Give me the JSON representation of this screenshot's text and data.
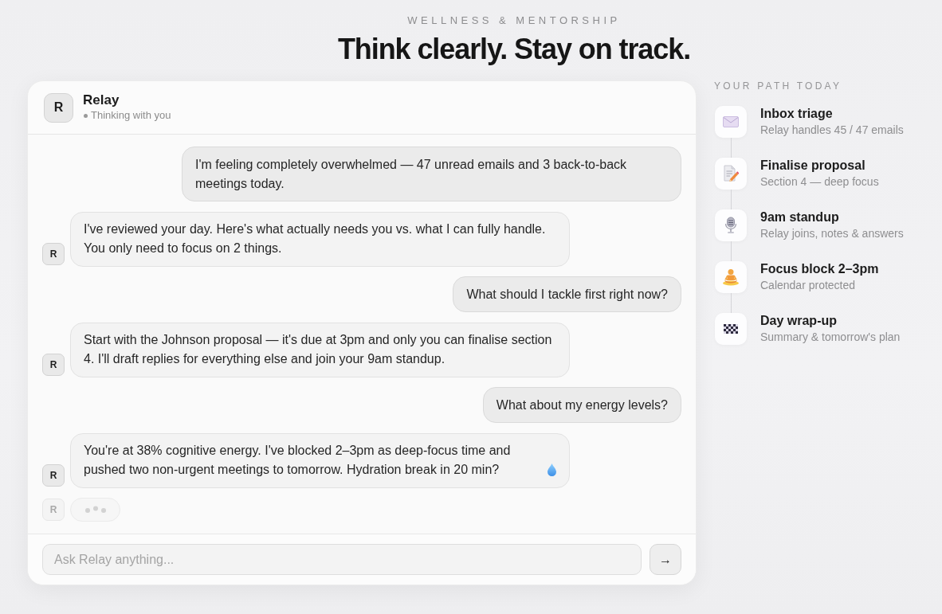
{
  "header": {
    "eyebrow": "WELLNESS & MENTORSHIP",
    "title": "Think clearly. Stay on track."
  },
  "chat": {
    "assistant": {
      "avatar": "R",
      "name": "Relay",
      "status": "Thinking with you"
    },
    "messages": [
      {
        "kind": "user",
        "text": "I'm feeling completely overwhelmed — 47 unread emails and 3 back-to-back meetings today."
      },
      {
        "kind": "assistant",
        "avatar": "R",
        "text": "I've reviewed your day. Here's what actually needs you vs. what I can fully handle. You only need to focus on 2 things."
      },
      {
        "kind": "user",
        "text": "What should I tackle first right now?"
      },
      {
        "kind": "assistant",
        "avatar": "R",
        "text": "Start with the Johnson proposal — it's due at 3pm and only you can finalise section 4. I'll draft replies for everything else and join your 9am standup."
      },
      {
        "kind": "user",
        "text": "What about my energy levels?"
      },
      {
        "kind": "assistant",
        "avatar": "R",
        "text": "You're at 38% cognitive energy. I've blocked 2–3pm as deep-focus time and pushed two non-urgent meetings to tomorrow. Hydration break in 20 min?"
      }
    ],
    "typing": {
      "avatar": "R"
    },
    "composer": {
      "placeholder": "Ask Relay anything...",
      "send_label": "→"
    }
  },
  "path": {
    "title": "YOUR PATH TODAY",
    "steps": [
      {
        "title": "Inbox triage",
        "subtitle": "Relay handles 45 / 47 emails"
      },
      {
        "title": "Finalise proposal",
        "subtitle": "Section 4 — deep focus"
      },
      {
        "title": "9am standup",
        "subtitle": "Relay joins, notes & answers"
      },
      {
        "title": "Focus block 2–3pm",
        "subtitle": "Calendar protected"
      },
      {
        "title": "Day wrap-up",
        "subtitle": "Summary & tomorrow's plan"
      }
    ]
  }
}
